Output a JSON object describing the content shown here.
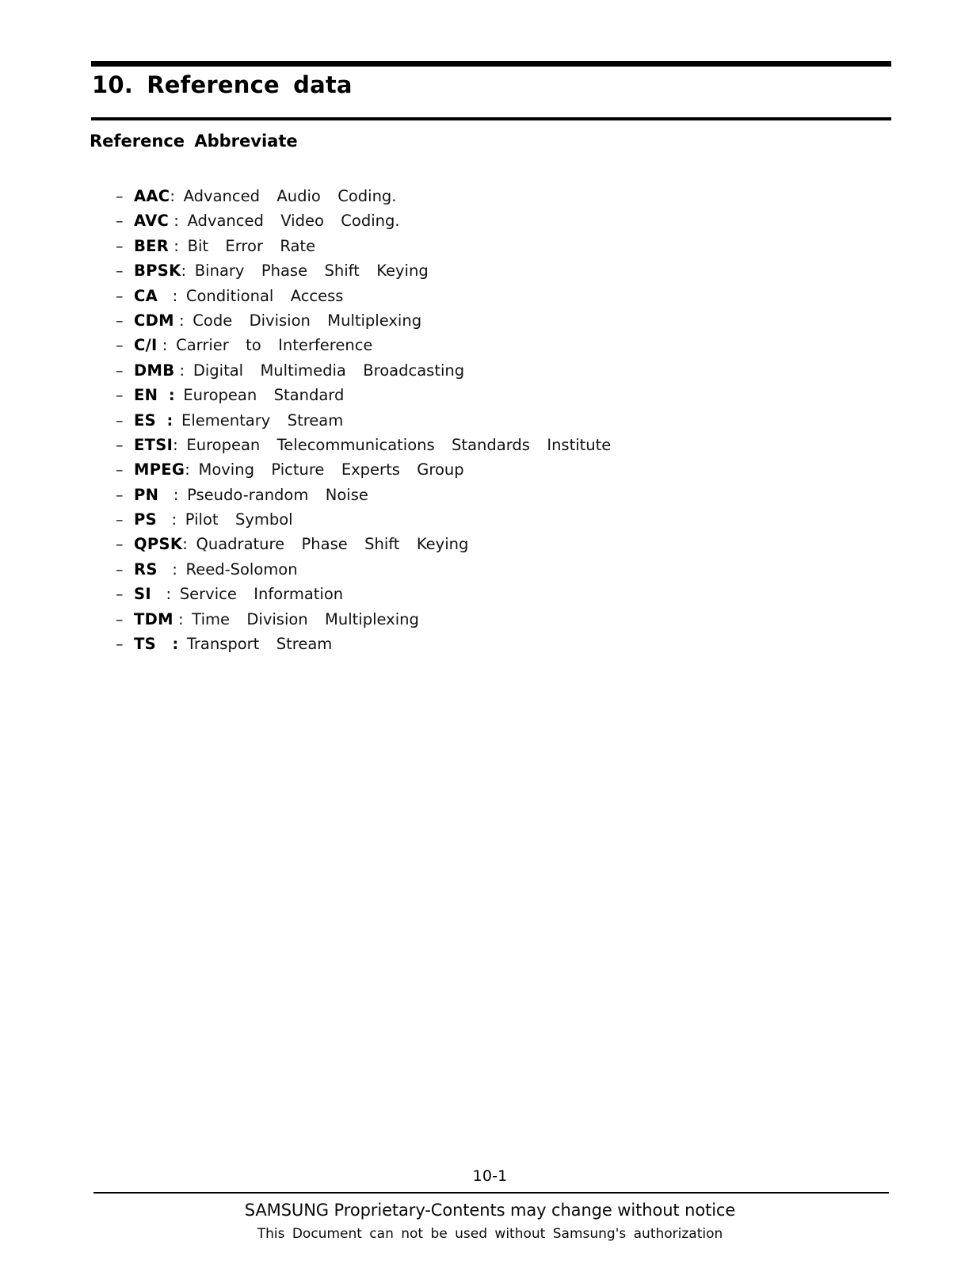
{
  "document": {
    "chapter_title": "10.  Reference  data",
    "section_heading": "Reference  Abbreviate"
  },
  "abbreviations": {
    "bullet_glyph": "–",
    "items": [
      {
        "term": "AAC",
        "sep": ":",
        "sep_bold": false,
        "definition": " Advanced  Audio  Coding."
      },
      {
        "term": "AVC",
        "sep": " :",
        "sep_bold": false,
        "definition": " Advanced  Video  Coding."
      },
      {
        "term": "BER",
        "sep": " :",
        "sep_bold": false,
        "definition": " Bit  Error  Rate"
      },
      {
        "term": "BPSK",
        "sep": ":",
        "sep_bold": false,
        "definition": " Binary  Phase  Shift  Keying"
      },
      {
        "term": "CA",
        "sep": "   :",
        "sep_bold": false,
        "definition": " Conditional  Access"
      },
      {
        "term": "CDM",
        "sep": " :",
        "sep_bold": false,
        "definition": " Code  Division  Multiplexing"
      },
      {
        "term": "C/I",
        "sep": " :",
        "sep_bold": false,
        "definition": " Carrier  to  Interference"
      },
      {
        "term": "DMB",
        "sep": " :",
        "sep_bold": false,
        "definition": " Digital  Multimedia  Broadcasting"
      },
      {
        "term": "EN",
        "sep": "  :",
        "sep_bold": true,
        "definition": " European  Standard"
      },
      {
        "term": "ES",
        "sep": "  :",
        "sep_bold": true,
        "definition": " Elementary  Stream"
      },
      {
        "term": "ETSI",
        "sep": ":",
        "sep_bold": false,
        "definition": " European  Telecommunications  Standards  Institute"
      },
      {
        "term": "MPEG",
        "sep": ":",
        "sep_bold": false,
        "definition": " Moving  Picture  Experts  Group"
      },
      {
        "term": "PN",
        "sep": "   :",
        "sep_bold": false,
        "definition": " Pseudo-random  Noise"
      },
      {
        "term": "PS",
        "sep": "   :",
        "sep_bold": false,
        "definition": " Pilot  Symbol"
      },
      {
        "term": "QPSK",
        "sep": ":",
        "sep_bold": false,
        "definition": " Quadrature  Phase  Shift  Keying"
      },
      {
        "term": "RS",
        "sep": "   :",
        "sep_bold": false,
        "definition": " Reed-Solomon"
      },
      {
        "term": "SI",
        "sep": "   :",
        "sep_bold": false,
        "definition": " Service  Information"
      },
      {
        "term": "TDM",
        "sep": " :",
        "sep_bold": false,
        "definition": " Time  Division  Multiplexing"
      },
      {
        "term": "TS",
        "sep": "   :",
        "sep_bold": true,
        "definition": " Transport  Stream"
      }
    ]
  },
  "footer": {
    "page_number": "10-1",
    "notice_line_1": "SAMSUNG Proprietary-Contents may change without notice",
    "notice_line_2": "This Document can not be used without Samsung's authorization"
  }
}
